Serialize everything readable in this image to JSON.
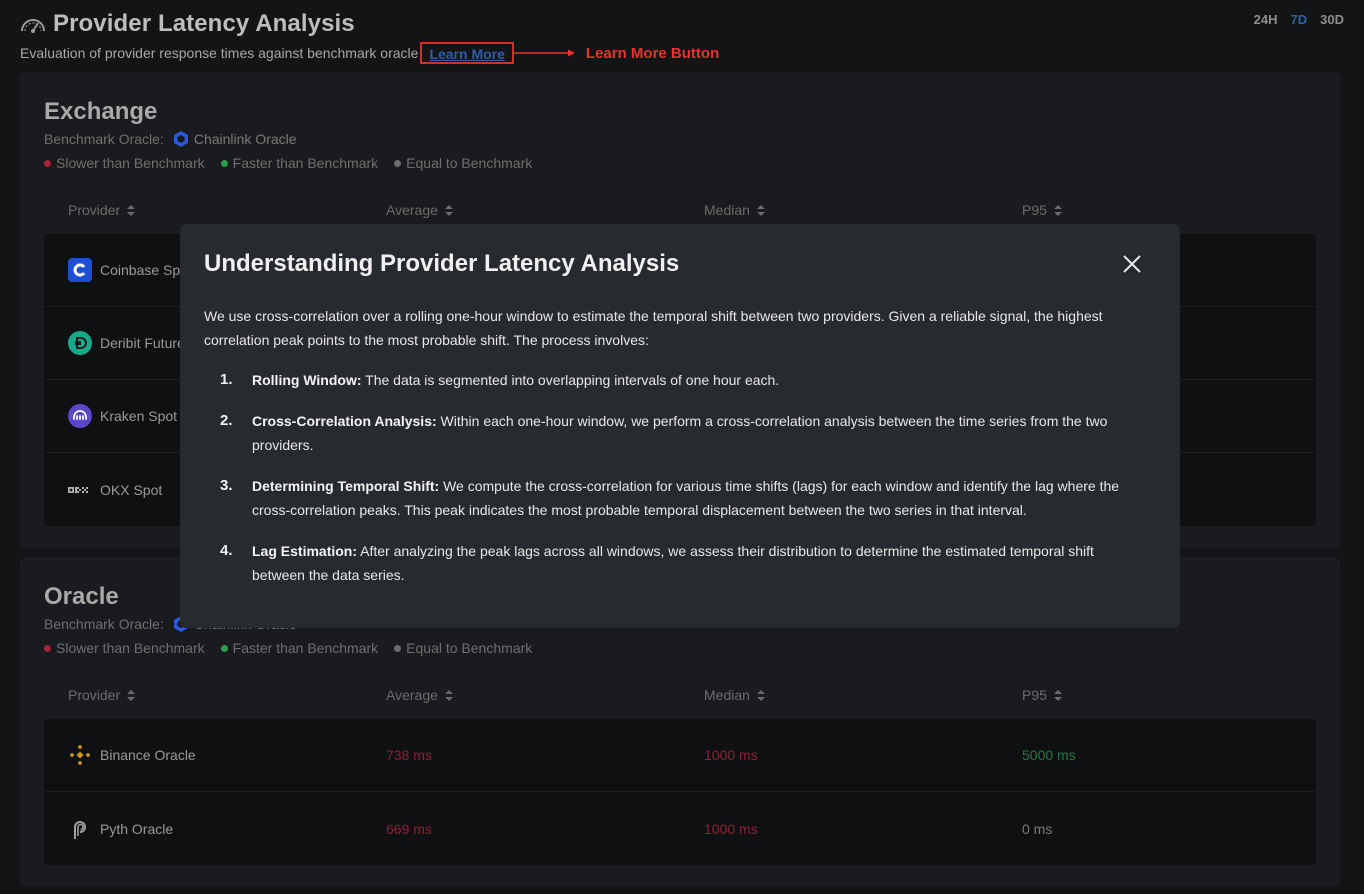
{
  "header": {
    "title": "Provider Latency Analysis",
    "subtitle": "Evaluation of provider response times against benchmark oracle",
    "learn_more": "Learn More",
    "annotation_label": "Learn More Button",
    "annotation_color": "#e8322c"
  },
  "time_range": {
    "options": [
      "24H",
      "7D",
      "30D"
    ],
    "selected": "7D"
  },
  "exchange": {
    "title": "Exchange",
    "benchmark_label": "Benchmark Oracle:",
    "benchmark_name": "Chainlink Oracle",
    "legend": [
      "Slower than Benchmark",
      "Faster than Benchmark",
      "Equal to Benchmark"
    ],
    "columns": [
      "Provider",
      "Average",
      "Median",
      "P95"
    ],
    "rows": [
      {
        "provider": "Coinbase Spot",
        "icon": "coinbase-logo"
      },
      {
        "provider": "Deribit Futures",
        "icon": "deribit-logo"
      },
      {
        "provider": "Kraken Spot",
        "icon": "kraken-logo"
      },
      {
        "provider": "OKX Spot",
        "icon": "okx-logo"
      }
    ]
  },
  "oracle": {
    "title": "Oracle",
    "benchmark_label": "Benchmark Oracle:",
    "benchmark_name": "Chainlink Oracle",
    "legend": [
      "Slower than Benchmark",
      "Faster than Benchmark",
      "Equal to Benchmark"
    ],
    "columns": [
      "Provider",
      "Average",
      "Median",
      "P95"
    ],
    "rows": [
      {
        "provider": "Binance Oracle",
        "icon": "binance-logo",
        "average": "738 ms",
        "median": "1000 ms",
        "p95": "5000 ms"
      },
      {
        "provider": "Pyth Oracle",
        "icon": "pyth-logo",
        "average": "669 ms",
        "median": "1000 ms",
        "p95": "0 ms"
      }
    ]
  },
  "modal": {
    "title": "Understanding Provider Latency Analysis",
    "intro": "We use cross-correlation over a rolling one-hour window to estimate the temporal shift between two providers. Given a reliable signal, the highest correlation peak points to the most probable shift. The process involves:",
    "steps": [
      {
        "num": "1.",
        "term": "Rolling Window:",
        "text": " The data is segmented into overlapping intervals of one hour each."
      },
      {
        "num": "2.",
        "term": "Cross-Correlation Analysis:",
        "text": " Within each one-hour window, we perform a cross-correlation analysis between the time series from the two providers."
      },
      {
        "num": "3.",
        "term": "Determining Temporal Shift:",
        "text": " We compute the cross-correlation for various time shifts (lags) for each window and identify the lag where the cross-correlation peaks. This peak indicates the most probable temporal displacement between the two series in that interval."
      },
      {
        "num": "4.",
        "term": "Lag Estimation:",
        "text": " After analyzing the peak lags across all windows, we assess their distribution to determine the estimated temporal shift between the data series."
      }
    ]
  },
  "colors": {
    "slower": "#a8233a",
    "faster": "#2e9a4e",
    "equal": "#6c6c6c",
    "accent": "#2f5fa5"
  }
}
